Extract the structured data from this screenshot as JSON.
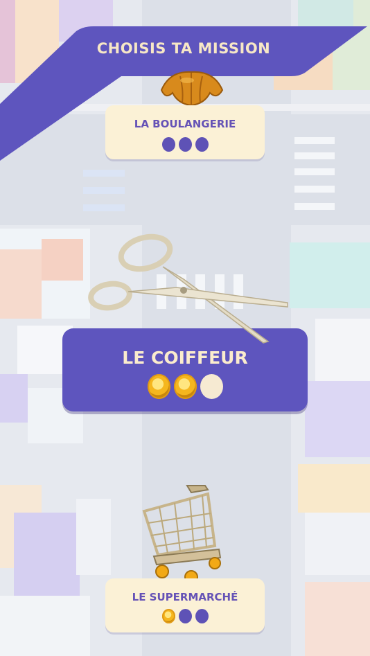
{
  "header": {
    "title": "CHOISIS TA MISSION"
  },
  "missions": [
    {
      "label": "LA BOULANGERIE",
      "icon": "croissant-icon",
      "coins": 0,
      "total": 3
    },
    {
      "label": "LE COIFFEUR",
      "icon": "scissors-icon",
      "coins": 2,
      "total": 3,
      "selected": true
    },
    {
      "label": "LE SUPERMARCHÉ",
      "icon": "shopping-cart-icon",
      "coins": 1,
      "total": 3
    }
  ],
  "colors": {
    "primary": "#5e55be",
    "card": "#fbf1d6",
    "cream_text": "#f7e7c6",
    "coin": "#f5b61e"
  }
}
